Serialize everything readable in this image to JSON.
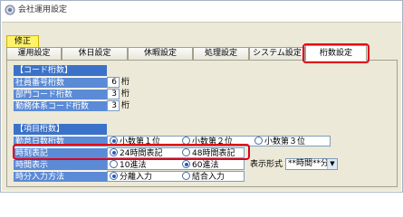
{
  "window": {
    "title": "会社運用設定"
  },
  "menu": {
    "fix_label": "修正"
  },
  "tabs": [
    {
      "label": "運用設定"
    },
    {
      "label": "休日設定"
    },
    {
      "label": "休暇設定"
    },
    {
      "label": "処理設定"
    },
    {
      "label": "システム設定"
    },
    {
      "label": "桁数設定"
    }
  ],
  "code_section": {
    "header": "【コード桁数】",
    "rows": [
      {
        "label": "社員番号桁数",
        "value": "6",
        "unit": "桁"
      },
      {
        "label": "部門コード桁数",
        "value": "3",
        "unit": "桁"
      },
      {
        "label": "勤務体系コード桁数",
        "value": "3",
        "unit": "桁"
      }
    ]
  },
  "item_section": {
    "header": "【項目桁数】",
    "rows": [
      {
        "label": "勤怠日数桁数",
        "options": [
          "小数第１位",
          "小数第２位",
          "小数第３位"
        ],
        "selected": 0
      },
      {
        "label": "時刻表記",
        "options": [
          "24時間表記",
          "48時間表記"
        ],
        "selected": 0
      },
      {
        "label": "時間表示",
        "options": [
          "10進法",
          "60進法"
        ],
        "selected": 1
      },
      {
        "label": "時分入力方法",
        "options": [
          "分離入力",
          "結合入力"
        ],
        "selected": 0
      }
    ],
    "display_format": {
      "label": "表示形式",
      "value": "**時間**分"
    }
  },
  "colors": {
    "section_header": "#3b72c9",
    "label_cell": "#5b8ad6",
    "highlight": "#e0001a",
    "menu_fix": "#fff36a"
  }
}
